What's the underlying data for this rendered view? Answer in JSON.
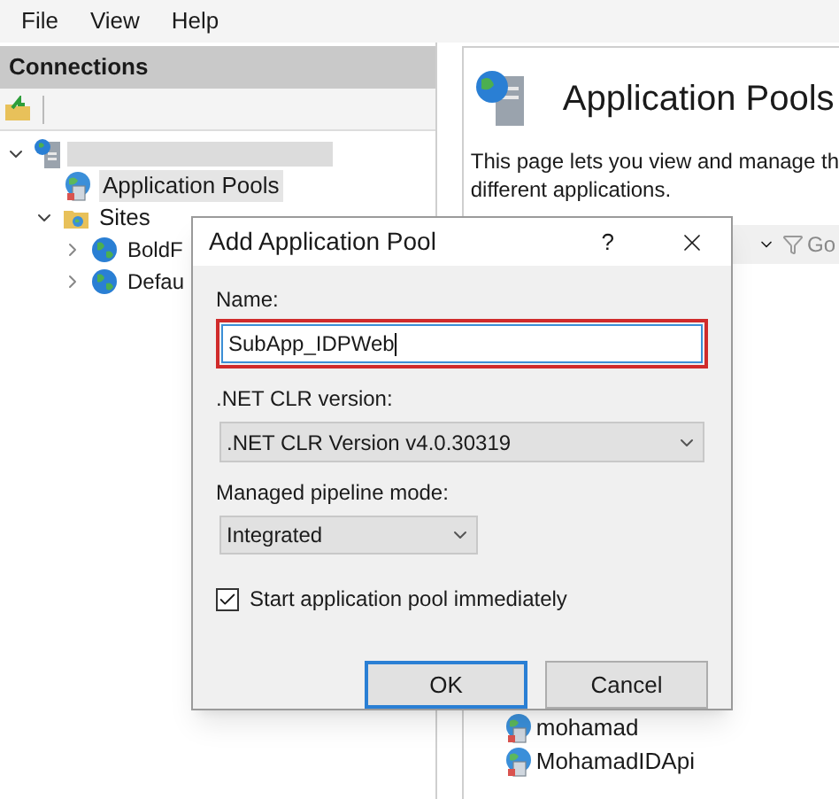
{
  "menu": [
    "File",
    "View",
    "Help"
  ],
  "connections": {
    "title": "Connections",
    "tree": [
      {
        "kind": "server",
        "expanded": true,
        "selected": false,
        "children": [
          {
            "kind": "pools",
            "label": "Application Pools",
            "selected": true
          },
          {
            "kind": "sites",
            "label": "Sites",
            "expanded": true,
            "selected": false,
            "children": [
              {
                "kind": "site",
                "label": "BoldF",
                "expanded": false,
                "selected": false
              },
              {
                "kind": "site",
                "label": "Defau",
                "expanded": false,
                "selected": false
              }
            ]
          }
        ]
      }
    ]
  },
  "page": {
    "title": "Application Pools",
    "description": "This page lets you view and manage th",
    "description_2": "different applications.",
    "go_label": "Go",
    "pools": [
      "mohamad",
      "MohamadIDApi"
    ]
  },
  "dialog": {
    "title": "Add Application Pool",
    "help": "?",
    "name_label": "Name:",
    "name_value": "SubApp_IDPWeb",
    "clr_label": ".NET CLR version:",
    "clr_value": ".NET CLR Version v4.0.30319",
    "pipeline_label": "Managed pipeline mode:",
    "pipeline_value": "Integrated",
    "start": {
      "label": "Start application pool immediately",
      "checked": true
    },
    "buttons": [
      {
        "label": "OK",
        "default": true
      },
      {
        "label": "Cancel",
        "default": false
      }
    ]
  }
}
